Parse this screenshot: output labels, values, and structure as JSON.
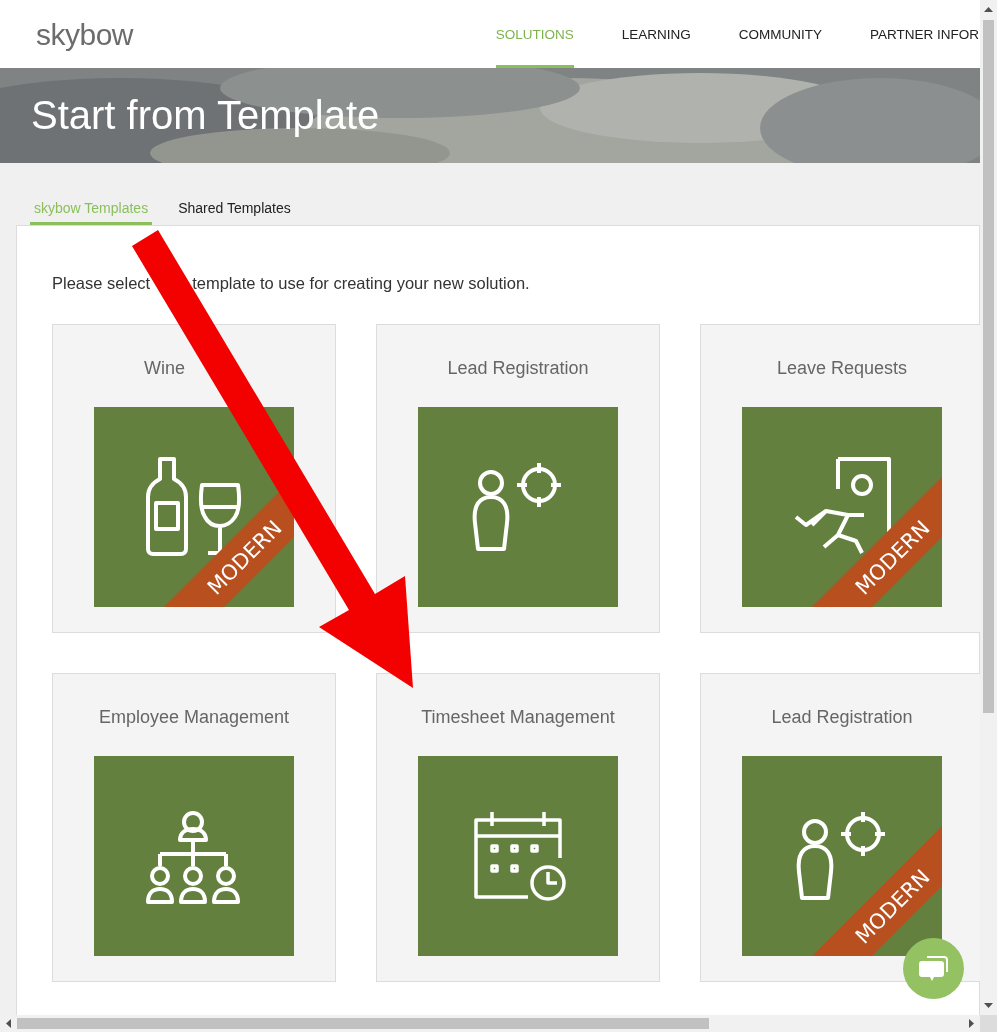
{
  "header": {
    "logo": "skybow",
    "nav": [
      {
        "label": "SOLUTIONS",
        "selected": true
      },
      {
        "label": "LEARNING",
        "selected": false
      },
      {
        "label": "COMMUNITY",
        "selected": false
      },
      {
        "label": "PARTNER INFOR",
        "selected": false
      }
    ]
  },
  "hero": {
    "title": "Start from Template"
  },
  "tabs": [
    {
      "label": "skybow Templates",
      "selected": true
    },
    {
      "label": "Shared Templates",
      "selected": false
    }
  ],
  "intro": [
    "Please select",
    "template to use for creating your new solution."
  ],
  "templates": [
    {
      "title": "Wine",
      "title_cut": true,
      "kind": "wine",
      "modern": true,
      "badge": "MODERN"
    },
    {
      "title": "Lead Registration",
      "kind": "lead",
      "modern": false
    },
    {
      "title": "Leave Requests",
      "kind": "leave",
      "modern": true,
      "badge": "MODERN"
    },
    {
      "title": "Employee Management",
      "kind": "org",
      "modern": false
    },
    {
      "title": "Timesheet Management",
      "kind": "timesheet",
      "modern": false
    },
    {
      "title": "Lead Registration",
      "kind": "lead",
      "modern": true,
      "badge": "MODERN"
    }
  ]
}
